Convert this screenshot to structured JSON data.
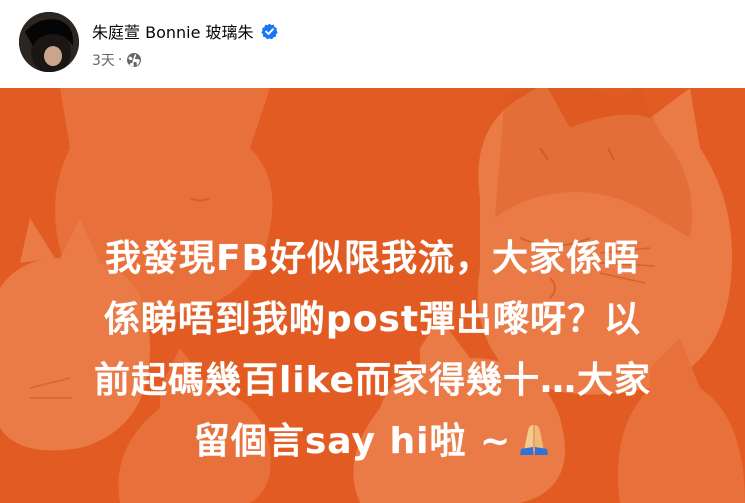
{
  "post": {
    "author_name": "朱庭萱 Bonnie 玻璃朱",
    "timestamp": "3天",
    "separator": "·",
    "privacy_icon": "globe-icon",
    "verified_icon": "verified-badge-icon",
    "verified_color": "#1877f2",
    "content_lines": [
      "我發現FB好似限我流，大家係唔",
      "係睇唔到我啲post彈出嚟呀？以",
      "前起碼幾百like而家得幾十…大家",
      "留個言say hi啦 ~"
    ],
    "trailing_emoji": "folded-hands-icon",
    "background_color": "#e15b22",
    "illustration": "cat-pattern-background"
  }
}
